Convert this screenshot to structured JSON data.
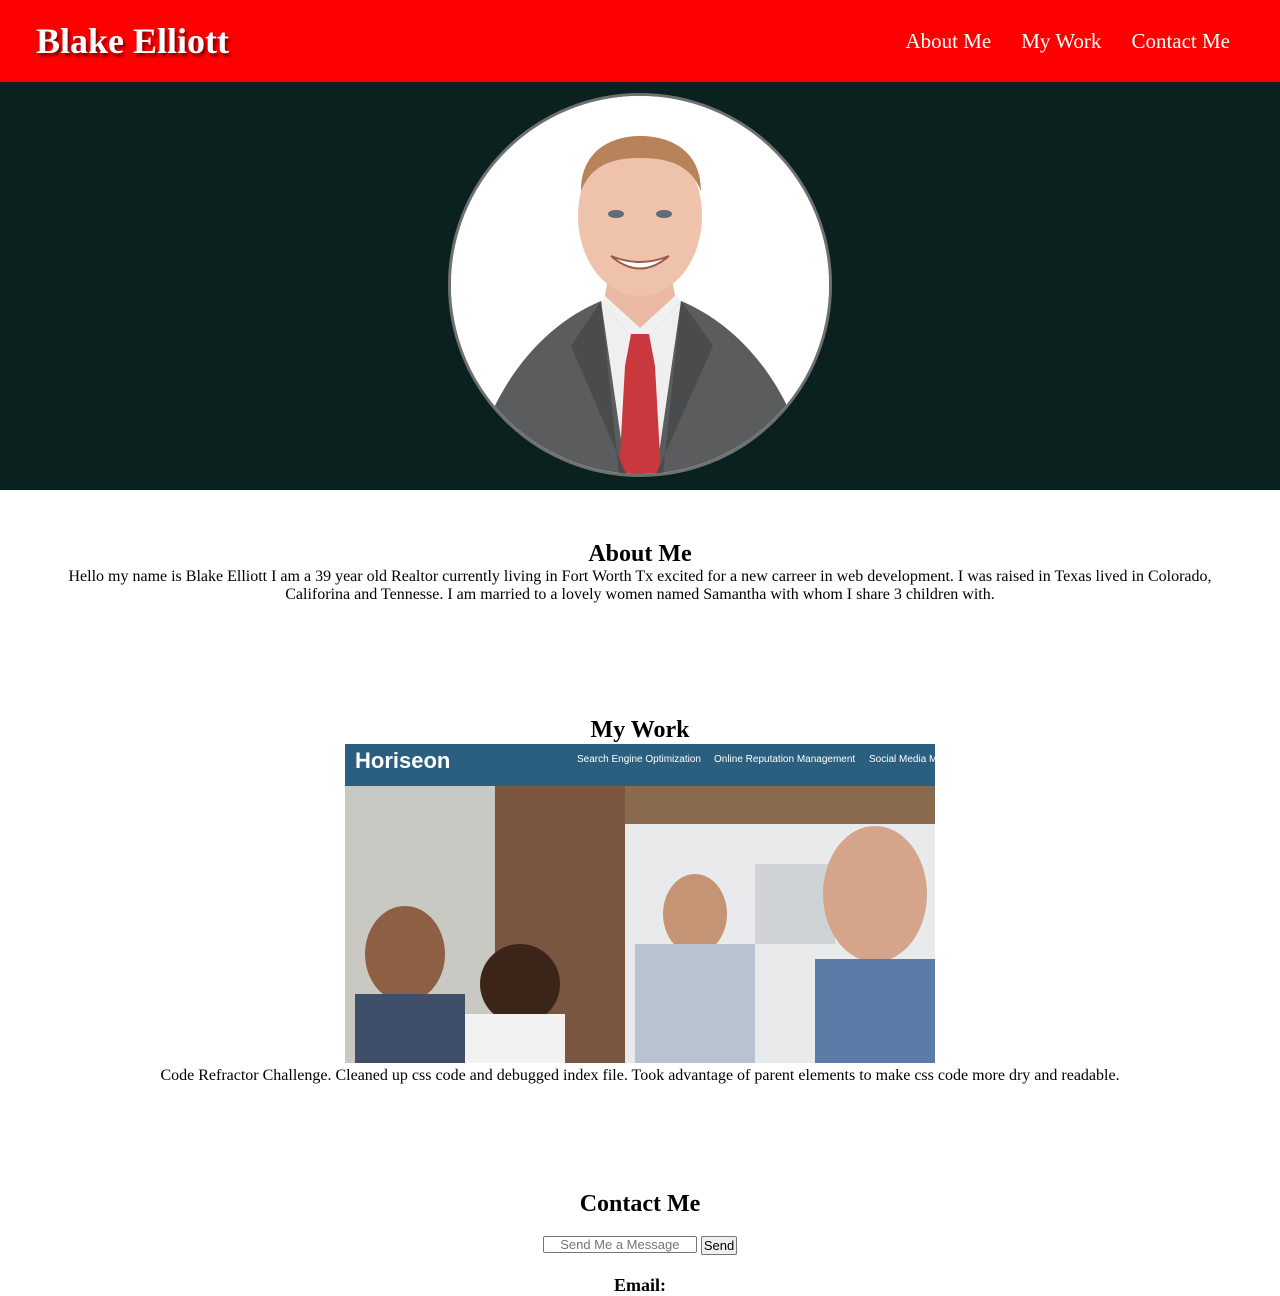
{
  "header": {
    "brand": "Blake Elliott",
    "nav": [
      "About Me",
      "My Work",
      "Contact Me"
    ]
  },
  "about": {
    "title": "About Me",
    "text": "Hello my name is Blake Elliott I am a 39 year old Realtor currently living in Fort Worth Tx excited for a new carreer in web development. I was raised in Texas lived in Colorado, Califorina and Tennesse. I am married to a lovely women named Samantha with whom I share 3 children with."
  },
  "work": {
    "title": "My Work",
    "screenshot": {
      "logo": "Horiseon",
      "nav": [
        "Search Engine Optimization",
        "Online Reputation Management",
        "Social Media M"
      ]
    },
    "description": "Code Refractor Challenge. Cleaned up css code and debugged index file. Took advantage of parent elements to make css code more dry and readable."
  },
  "contact": {
    "title": "Contact Me",
    "message_placeholder": "Send Me a Message",
    "send_label": "Send",
    "email_label": "Email:"
  },
  "colors": {
    "header": "#ff0000",
    "hero": "#0a2120",
    "horiseon_bar": "#2a5f7f"
  }
}
